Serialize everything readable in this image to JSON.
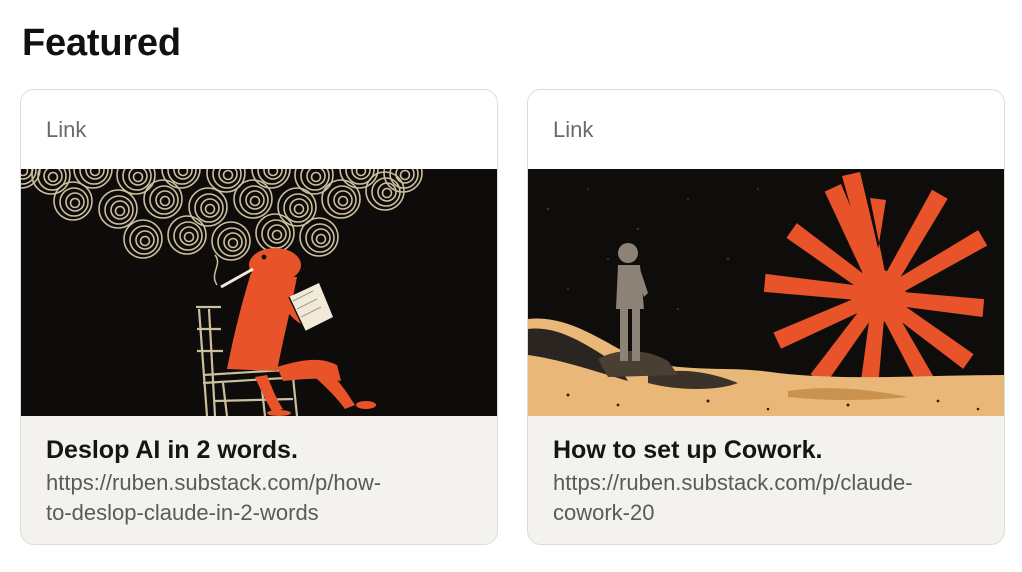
{
  "section": {
    "title": "Featured"
  },
  "cards": [
    {
      "type_label": "Link",
      "title": "Deslop AI in 2 words.",
      "url_line1": "https://ruben.substack.com/p/how-",
      "url_line2": "to-deslop-claude-in-2-words",
      "image_icon": "frog-reading-smoking-illustration"
    },
    {
      "type_label": "Link",
      "title": "How to set up Cowork.",
      "url_line1": "https://ruben.substack.com/p/claude-",
      "url_line2": "cowork-20",
      "image_icon": "child-watching-orange-sunburst-illustration"
    }
  ],
  "colors": {
    "card_border": "#dedcd7",
    "card_body_bg": "#f3f2ef",
    "illustration_orange": "#e8532a",
    "illustration_sand": "#e9b777",
    "illustration_smoke": "#cdbf9e"
  }
}
